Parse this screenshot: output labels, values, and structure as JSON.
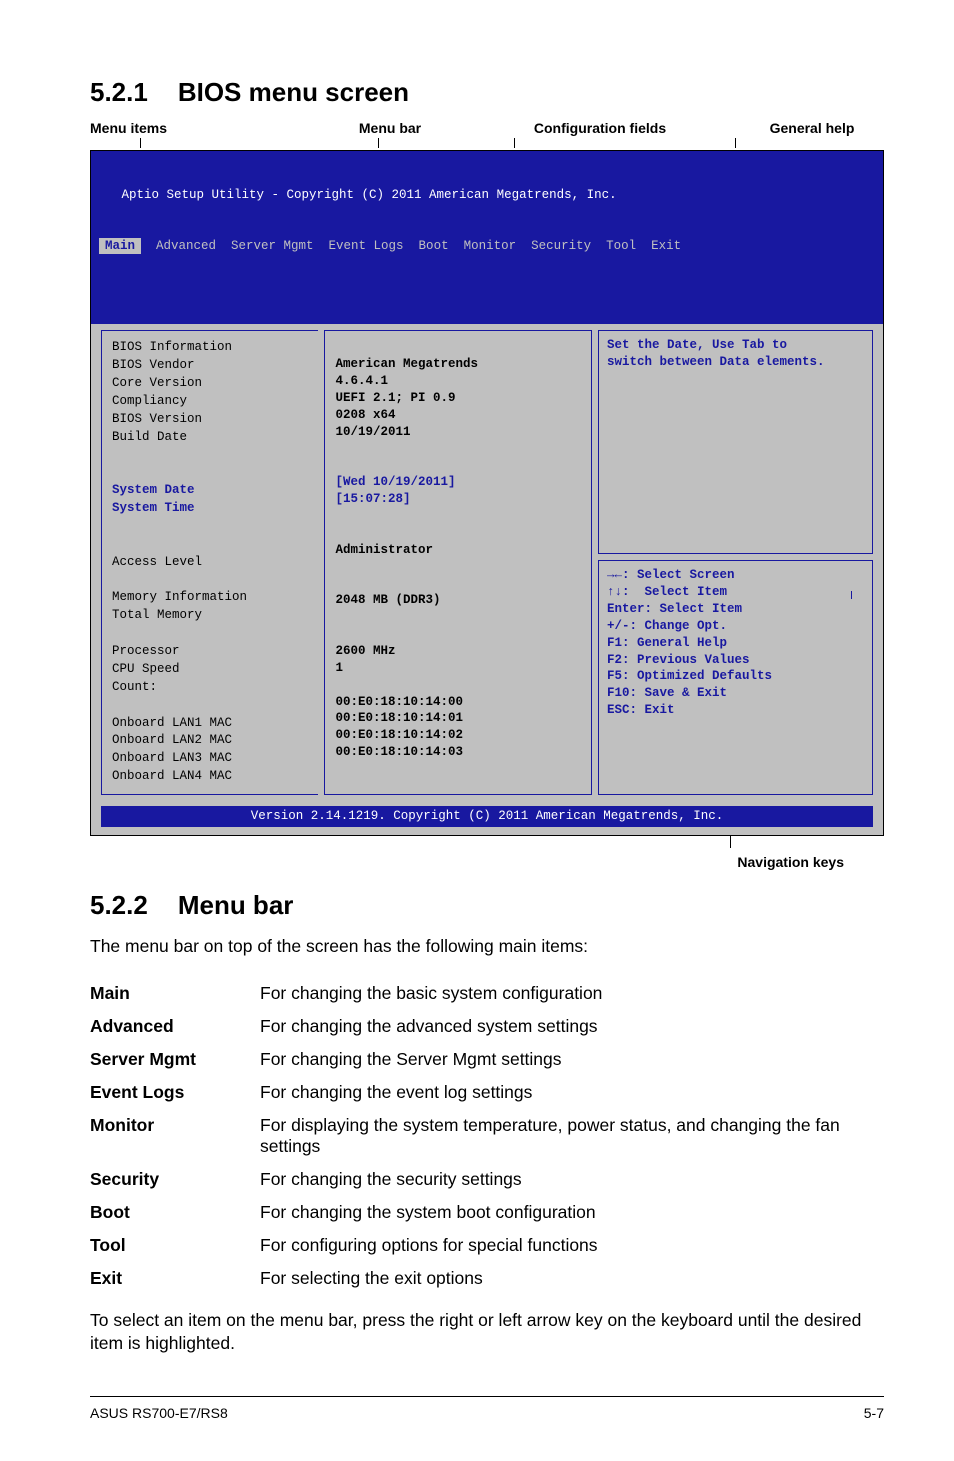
{
  "sections": {
    "s521": {
      "num": "5.2.1",
      "title": "BIOS menu screen"
    },
    "s522": {
      "num": "5.2.2",
      "title": "Menu bar"
    }
  },
  "annot": {
    "a1": "Menu items",
    "a2": "Menu bar",
    "a3": "Configuration fields",
    "a4": "General help",
    "nav": "Navigation keys"
  },
  "bios": {
    "top1": "   Aptio Setup Utility - Copyright (C) 2011 American Megatrends, Inc.",
    "tabs": {
      "sel": "Main",
      "rest": "  Advanced  Server Mgmt  Event Logs  Boot  Monitor  Security  Tool  Exit"
    },
    "left": [
      "BIOS Information",
      "BIOS Vendor",
      "Core Version",
      "Compliancy",
      "BIOS Version",
      "Build Date",
      "",
      "",
      [
        "blue",
        "System Date"
      ],
      [
        "blue",
        "System Time"
      ],
      "",
      "",
      "Access Level",
      "",
      "Memory Information",
      "Total Memory",
      "",
      "Processor",
      "CPU Speed",
      "Count:",
      "",
      "Onboard LAN1 MAC",
      "Onboard LAN2 MAC",
      "Onboard LAN3 MAC",
      "Onboard LAN4 MAC"
    ],
    "mid": [
      "",
      "American Megatrends",
      "4.6.4.1",
      "UEFI 2.1; PI 0.9",
      "0208 x64",
      "10/19/2011",
      "",
      "",
      [
        "blue",
        "[Wed 10/19/2011]"
      ],
      [
        "blue",
        "[15:07:28]"
      ],
      "",
      "",
      "Administrator",
      "",
      "",
      "2048 MB (DDR3)",
      "",
      "",
      "2600 MHz",
      "1",
      "",
      "00:E0:18:10:14:00",
      "00:E0:18:10:14:01",
      "00:E0:18:10:14:02",
      "00:E0:18:10:14:03"
    ],
    "right_upper": [
      "Set the Date, Use Tab to",
      "switch between Data elements."
    ],
    "right_lower": [
      "→←: Select Screen",
      "↑↓:  Select Item",
      "Enter: Select Item",
      "+/-: Change Opt.",
      "F1: General Help",
      "F2: Previous Values",
      "F5: Optimized Defaults",
      "F10: Save & Exit",
      "ESC: Exit"
    ],
    "footer": "Version 2.14.1219. Copyright (C) 2011 American Megatrends, Inc."
  },
  "menubar_intro": "The menu bar on top of the screen has the following main items:",
  "menubar_items": [
    {
      "k": "Main",
      "v": "For changing the basic system configuration"
    },
    {
      "k": "Advanced",
      "v": "For changing the advanced system settings"
    },
    {
      "k": "Server Mgmt",
      "v": "For changing the Server Mgmt settings"
    },
    {
      "k": "Event Logs",
      "v": "For changing the event log settings"
    },
    {
      "k": "Monitor",
      "v": "For displaying the system temperature, power status, and changing the fan settings"
    },
    {
      "k": "Security",
      "v": "For changing the security settings"
    },
    {
      "k": "Boot",
      "v": "For changing the system boot configuration"
    },
    {
      "k": "Tool",
      "v": "For configuring options for special functions"
    },
    {
      "k": "Exit",
      "v": "For selecting the exit options"
    }
  ],
  "closing": "To select an item on the menu bar, press the right or left arrow key on the keyboard until the desired item is highlighted.",
  "footer": {
    "left": "ASUS RS700-E7/RS8",
    "right": "5-7"
  }
}
